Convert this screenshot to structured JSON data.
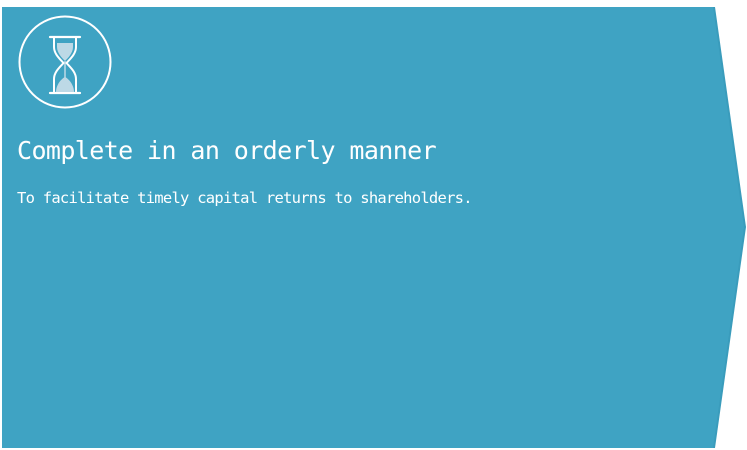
{
  "card": {
    "icon": "hourglass-icon",
    "title": "Complete in an orderly manner",
    "description": "To facilitate timely capital returns to shareholders."
  },
  "colors": {
    "panel": "#3fa3c3",
    "panel_edge": "#3a9cbc",
    "text": "#ffffff",
    "icon_line": "#ffffff",
    "icon_fill": "#bdd9e6"
  }
}
